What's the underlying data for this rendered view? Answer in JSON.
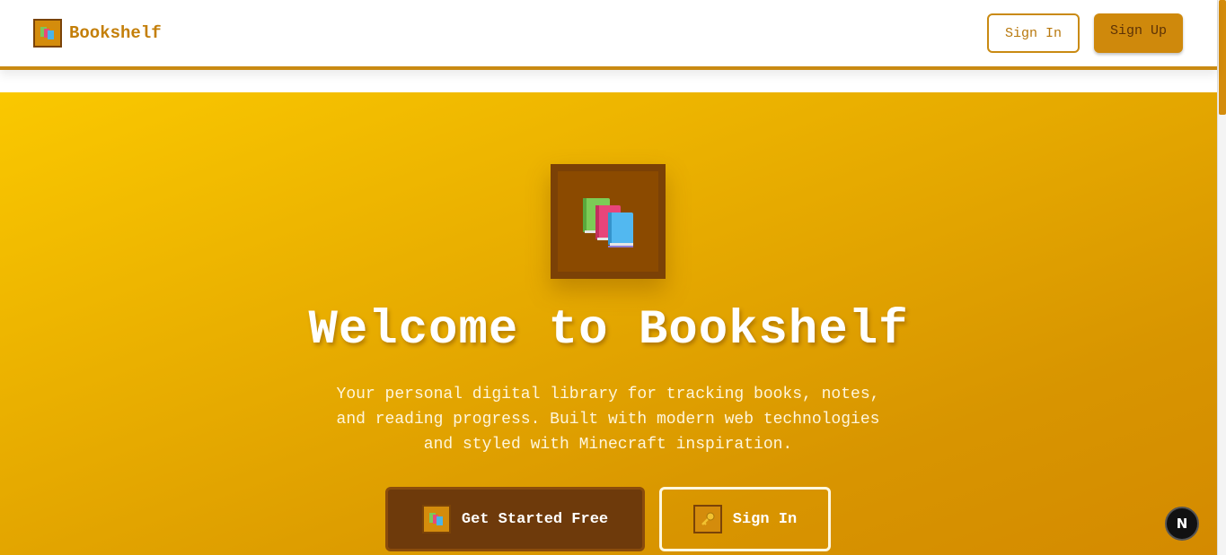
{
  "header": {
    "brand": "Bookshelf",
    "brand_icon": "books-icon",
    "signin_label": "Sign In",
    "signup_label": "Sign Up"
  },
  "hero": {
    "icon": "books-icon",
    "title": "Welcome to Bookshelf",
    "subtitle": "Your personal digital library for tracking books, notes, and reading progress. Built with modern web technologies and styled with Minecraft inspiration.",
    "cta_primary": "Get Started Free",
    "cta_secondary": "Sign In",
    "cta_secondary_icon": "key-icon"
  },
  "badge": {
    "label": "N"
  },
  "colors": {
    "accent": "#d48c0c",
    "brand_text": "#c47f09",
    "hero_gradient_start": "#fac800",
    "hero_gradient_end": "#d48a00",
    "primary_button": "#6e3a0b"
  }
}
